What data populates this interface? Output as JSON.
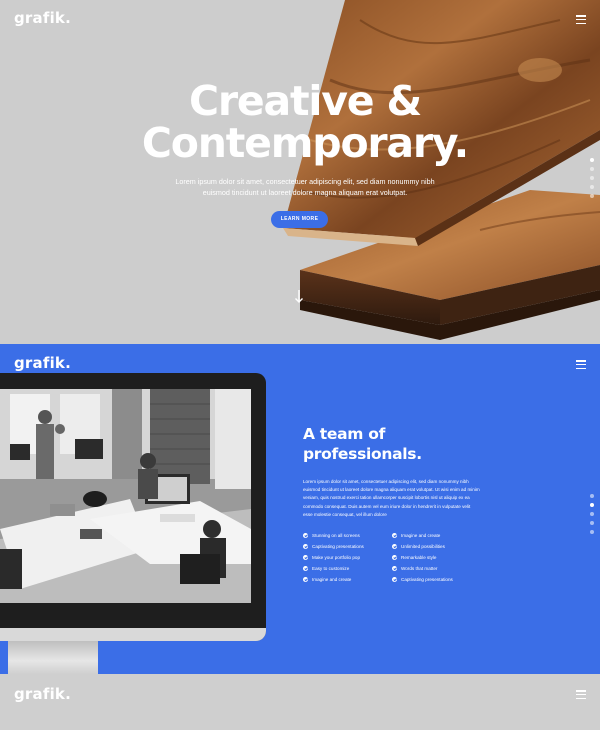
{
  "hero": {
    "logo": "grafik.",
    "title_line1": "Creative &",
    "title_line2": "Contemporary.",
    "subtitle_line1": "Lorem ipsum dolor sit amet, consectetuer adipiscing elit, sed diam nonummy nibh",
    "subtitle_line2": "euismod tincidunt ut laoreet dolore magna aliquam erat volutpat.",
    "button_label": "LEARN MORE",
    "menu_icon": "hamburger-menu-icon",
    "scroll_icon": "arrow-down-icon"
  },
  "team": {
    "logo": "grafik.",
    "title_line1": "A team of",
    "title_line2": "professionals.",
    "paragraph": "Lorem ipsum dolor sit amet, consectetuer adipiscing elit, sed diam nonummy nibh euismod tincidunt ut laoreet dolore magna aliquam erat volutpat. Ut wisi enim ad minim veniam, quis nostrud exerci tation ullamcorper suscipit lobortis nisl ut aliquip ex ea commodo consequat. Duis autem vel eum iriure dolor in hendrerit in vulputate velit esse molestie consequat, vel illum dolore",
    "features_left": [
      "Stunning on all screens",
      "Captivating presentations",
      "Make your portfolio pop",
      "Easy to customize",
      "Imagine and create"
    ],
    "features_right": [
      "Imagine and create",
      "Unlimited possibilities",
      "Remarkable style",
      "Words that matter",
      "Captivating presentations"
    ],
    "menu_icon": "hamburger-menu-icon"
  },
  "third": {
    "logo": "grafik.",
    "menu_icon": "hamburger-menu-icon"
  },
  "colors": {
    "accent": "#3b6ee7",
    "hero_bg": "#cdcdcd",
    "text_light": "#ffffff"
  }
}
